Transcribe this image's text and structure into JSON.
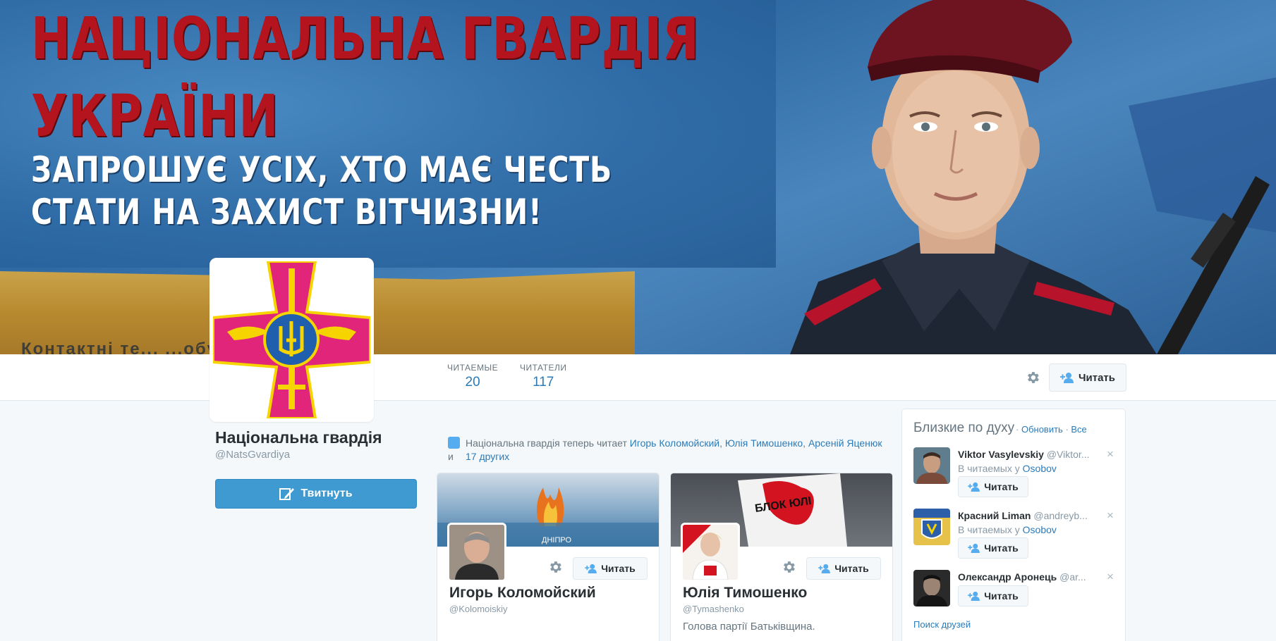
{
  "banner": {
    "line1": "НАЦІОНАЛЬНА ГВАРДІЯ",
    "line2": "УКРАЇНИ",
    "line3": "ЗАПРОШУЄ УСІХ, ХТО МАЄ ЧЕСТЬ",
    "line4": "СТАТИ НА ЗАХИСТ ВІТЧИЗНИ!",
    "bottom_text": "Контактні те... ...обувальних"
  },
  "stats": {
    "following_label": "ЧИТАЕМЫЕ",
    "following_value": "20",
    "followers_label": "ЧИТАТЕЛИ",
    "followers_value": "117"
  },
  "header_actions": {
    "gear_icon": "gear-icon",
    "follow_label": "Читать"
  },
  "profile": {
    "name": "Національна гвардія",
    "handle": "@NatsGvardiya",
    "tweet_button": "Твитнуть"
  },
  "activity": {
    "prefix": "Національна гвардія теперь читает ",
    "user1": "Игорь Коломойский",
    "sep1": ", ",
    "user2": "Юлія Тимошенко",
    "sep2": ", ",
    "user3": "Арсеній Яценюк",
    "connector": " и ",
    "others": "17 других"
  },
  "cards": [
    {
      "name": "Игорь Коломойский",
      "handle": "@Kolomoiskiy",
      "bio": "",
      "follow_label": "Читать",
      "header_text": "ДНІПРО"
    },
    {
      "name": "Юлія Тимошенко",
      "handle": "@Tymashenko",
      "bio": "Голова партії Батьківщина.",
      "follow_label": "Читать",
      "header_text": "БЛОК ЮЛІ"
    }
  ],
  "who_to_follow": {
    "title": "Близкие по духу",
    "refresh": "Обновить",
    "dot1": " · ",
    "all": "Все",
    "dot0": "· ",
    "find_friends": "Поиск друзей",
    "items": [
      {
        "name": "Viktor Vasylevskiy",
        "handle": "@Viktor...",
        "context_prefix": "В читаемых у ",
        "context_user": "Osobov",
        "follow_label": "Читать",
        "close": "×"
      },
      {
        "name": "Красний Liman",
        "handle": "@andreyb...",
        "context_prefix": "В читаемых у ",
        "context_user": "Osobov",
        "follow_label": "Читать",
        "close": "×"
      },
      {
        "name": "Олександр Аронець",
        "handle": "@ar...",
        "context_prefix": "",
        "context_user": "",
        "follow_label": "Читать",
        "close": "×"
      }
    ]
  }
}
